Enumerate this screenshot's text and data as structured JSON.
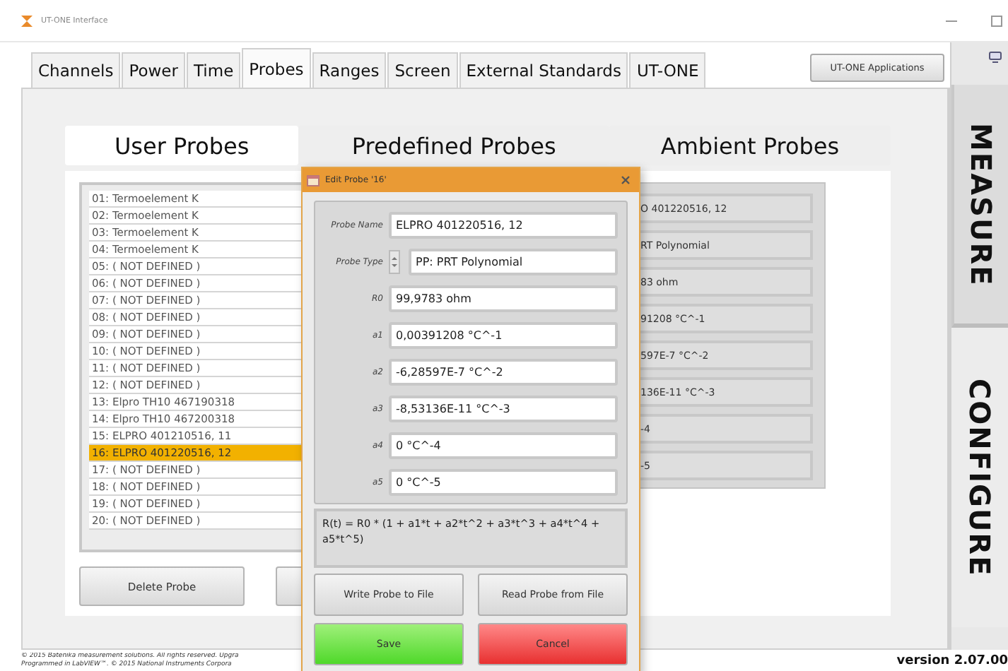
{
  "window": {
    "title": "UT-ONE Interface"
  },
  "tabs": [
    {
      "label": "Channels",
      "selected": false
    },
    {
      "label": "Power",
      "selected": false
    },
    {
      "label": "Time",
      "selected": false
    },
    {
      "label": "Probes",
      "selected": true
    },
    {
      "label": "Ranges",
      "selected": false
    },
    {
      "label": "Screen",
      "selected": false
    },
    {
      "label": "External Standards",
      "selected": false
    },
    {
      "label": "UT-ONE",
      "selected": false
    }
  ],
  "apps_button": "UT-ONE Applications",
  "side_tabs": [
    {
      "label": "MEASURE",
      "selected": false
    },
    {
      "label": "CONFIGURE",
      "selected": true
    }
  ],
  "probe_tabs": [
    {
      "label": "User Probes",
      "selected": true
    },
    {
      "label": "Predefined Probes",
      "selected": false
    },
    {
      "label": "Ambient Probes",
      "selected": false
    }
  ],
  "probes": [
    {
      "label": "01: Termoelement K",
      "selected": false
    },
    {
      "label": "02: Termoelement K",
      "selected": false
    },
    {
      "label": "03: Termoelement K",
      "selected": false
    },
    {
      "label": "04: Termoelement K",
      "selected": false
    },
    {
      "label": "05: ( NOT DEFINED )",
      "selected": false
    },
    {
      "label": "06: ( NOT DEFINED )",
      "selected": false
    },
    {
      "label": "07: ( NOT DEFINED )",
      "selected": false
    },
    {
      "label": "08: ( NOT DEFINED )",
      "selected": false
    },
    {
      "label": "09: ( NOT DEFINED )",
      "selected": false
    },
    {
      "label": "10: ( NOT DEFINED )",
      "selected": false
    },
    {
      "label": "11: ( NOT DEFINED )",
      "selected": false
    },
    {
      "label": "12: ( NOT DEFINED )",
      "selected": false
    },
    {
      "label": "13: Elpro TH10 467190318",
      "selected": false
    },
    {
      "label": "14: Elpro TH10 467200318",
      "selected": false
    },
    {
      "label": "15: ELPRO 401210516, 11",
      "selected": false
    },
    {
      "label": "16: ELPRO 401220516, 12",
      "selected": true
    },
    {
      "label": "17: ( NOT DEFINED )",
      "selected": false
    },
    {
      "label": "18: ( NOT DEFINED )",
      "selected": false
    },
    {
      "label": "19: ( NOT DEFINED )",
      "selected": false
    },
    {
      "label": "20: ( NOT DEFINED )",
      "selected": false
    }
  ],
  "list_buttons": [
    "Delete Probe"
  ],
  "background_fields": [
    "O 401220516, 12",
    "RT Polynomial",
    "83 ohm",
    "91208 °C^-1",
    "597E-7 °C^-2",
    "136E-11 °C^-3",
    "-4",
    "-5"
  ],
  "dialog": {
    "title": "Edit Probe '16'",
    "fields": [
      {
        "label": "Probe Name",
        "value": "ELPRO 401220516, 12",
        "kind": "text"
      },
      {
        "label": "Probe Type",
        "value": "PP: PRT Polynomial",
        "kind": "spinner"
      },
      {
        "label": "R0",
        "value": "99,9783 ohm",
        "kind": "text"
      },
      {
        "label": "a1",
        "value": "0,00391208 °C^-1",
        "kind": "text"
      },
      {
        "label": "a2",
        "value": "-6,28597E-7 °C^-2",
        "kind": "text"
      },
      {
        "label": "a3",
        "value": "-8,53136E-11 °C^-3",
        "kind": "text"
      },
      {
        "label": "a4",
        "value": "0 °C^-4",
        "kind": "text"
      },
      {
        "label": "a5",
        "value": "0 °C^-5",
        "kind": "text"
      }
    ],
    "formula": "R(t) = R0 * (1 + a1*t + a2*t^2 + a3*t^3 + a4*t^4 + a5*t^5)",
    "buttons": [
      {
        "label": "Write Probe to File",
        "kind": "plain"
      },
      {
        "label": "Read Probe from File",
        "kind": "plain"
      },
      {
        "label": "Save",
        "kind": "ok"
      },
      {
        "label": "Cancel",
        "kind": "cancel"
      }
    ]
  },
  "footer": {
    "lines": [
      "© 2015 Batenika measurement solutions. All rights reserved. Upgra",
      "Programmed in LabVIEW™. © 2015 National Instruments Corpora"
    ],
    "version": "version 2.07.00"
  }
}
